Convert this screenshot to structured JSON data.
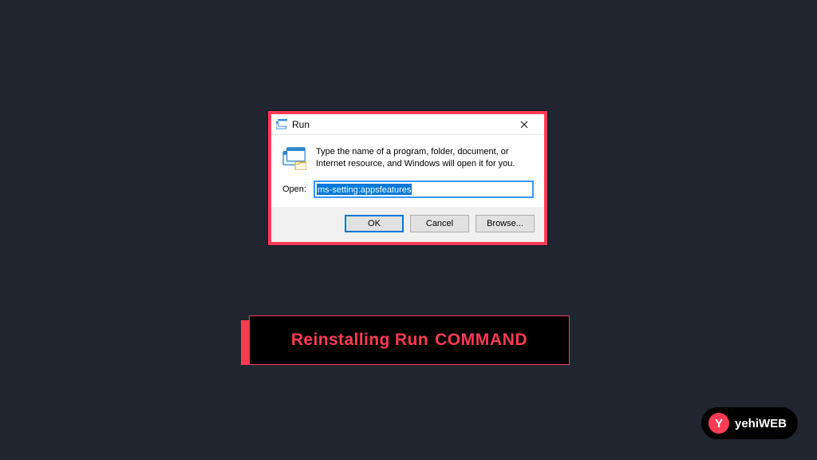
{
  "run": {
    "title": "Run",
    "message": "Type the name of a program, folder, document, or Internet resource, and Windows will open it for you.",
    "open_label": "Open:",
    "open_value": "ms-setting:appsfeatures",
    "buttons": {
      "ok": "OK",
      "cancel": "Cancel",
      "browse": "Browse..."
    }
  },
  "caption": {
    "part1": "Reinstalling Run",
    "part2": "COMMAND"
  },
  "brand": {
    "mark": "Y",
    "text_a": "yehi",
    "text_b": "WEB"
  }
}
